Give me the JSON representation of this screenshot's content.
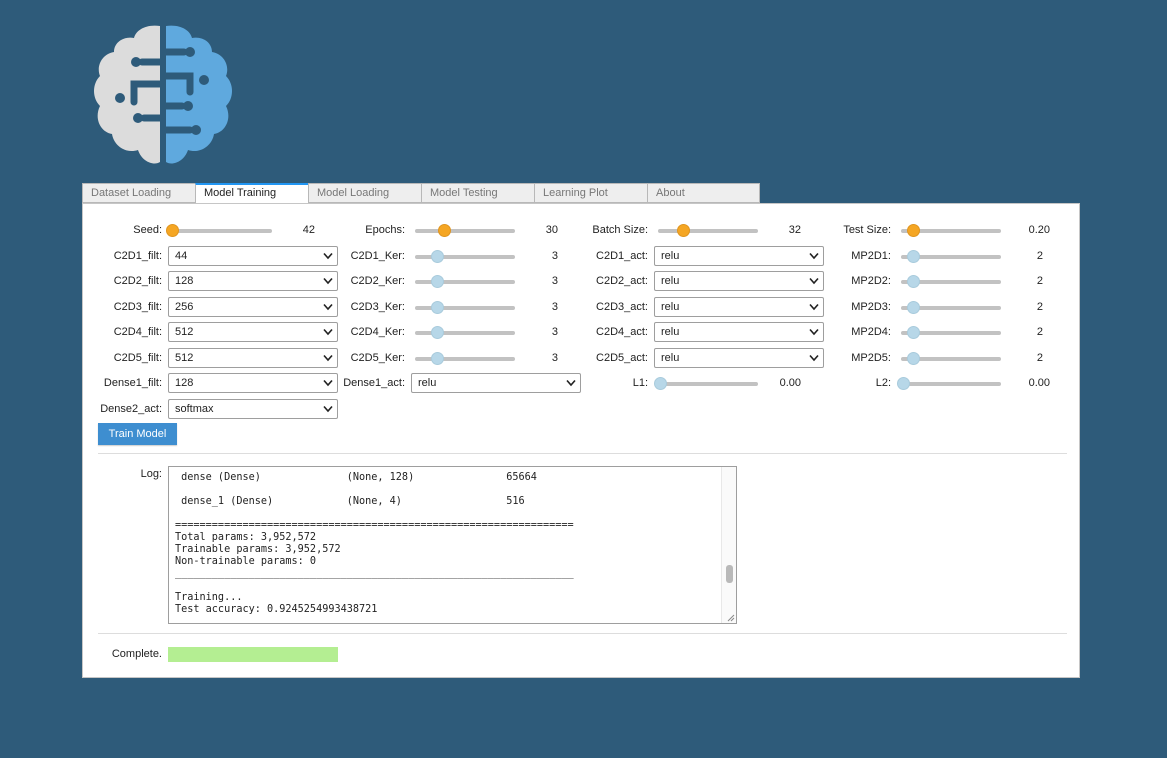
{
  "logo": {
    "icon": "brain-logo-icon",
    "colors": {
      "left": "#dcdcdc",
      "right": "#5fa9de"
    }
  },
  "tabs": [
    {
      "label": "Dataset Loading",
      "active": false
    },
    {
      "label": "Model Training",
      "active": true
    },
    {
      "label": "Model Loading",
      "active": false
    },
    {
      "label": "Model Testing",
      "active": false
    },
    {
      "label": "Learning Plot",
      "active": false
    },
    {
      "label": "About",
      "active": false
    }
  ],
  "sliders": {
    "seed": {
      "label": "Seed:",
      "value": "42"
    },
    "epochs": {
      "label": "Epochs:",
      "value": "30"
    },
    "batch_size": {
      "label": "Batch Size:",
      "value": "32"
    },
    "test_size": {
      "label": "Test Size:",
      "value": "0.20"
    },
    "c2d1_ker": {
      "label": "C2D1_Ker:",
      "value": "3"
    },
    "c2d2_ker": {
      "label": "C2D2_Ker:",
      "value": "3"
    },
    "c2d3_ker": {
      "label": "C2D3_Ker:",
      "value": "3"
    },
    "c2d4_ker": {
      "label": "C2D4_Ker:",
      "value": "3"
    },
    "c2d5_ker": {
      "label": "C2D5_Ker:",
      "value": "3"
    },
    "mp2d1": {
      "label": "MP2D1:",
      "value": "2"
    },
    "mp2d2": {
      "label": "MP2D2:",
      "value": "2"
    },
    "mp2d3": {
      "label": "MP2D3:",
      "value": "2"
    },
    "mp2d4": {
      "label": "MP2D4:",
      "value": "2"
    },
    "mp2d5": {
      "label": "MP2D5:",
      "value": "2"
    },
    "l1": {
      "label": "L1:",
      "value": "0.00"
    },
    "l2": {
      "label": "L2:",
      "value": "0.00"
    }
  },
  "selects": {
    "c2d1_filt": {
      "label": "C2D1_filt:",
      "value": "44"
    },
    "c2d2_filt": {
      "label": "C2D2_filt:",
      "value": "128"
    },
    "c2d3_filt": {
      "label": "C2D3_filt:",
      "value": "256"
    },
    "c2d4_filt": {
      "label": "C2D4_filt:",
      "value": "512"
    },
    "c2d5_filt": {
      "label": "C2D5_filt:",
      "value": "512"
    },
    "dense1_filt": {
      "label": "Dense1_filt:",
      "value": "128"
    },
    "dense2_act": {
      "label": "Dense2_act:",
      "value": "softmax"
    },
    "c2d1_act": {
      "label": "C2D1_act:",
      "value": "relu"
    },
    "c2d2_act": {
      "label": "C2D2_act:",
      "value": "relu"
    },
    "c2d3_act": {
      "label": "C2D3_act:",
      "value": "relu"
    },
    "c2d4_act": {
      "label": "C2D4_act:",
      "value": "relu"
    },
    "c2d5_act": {
      "label": "C2D5_act:",
      "value": "relu"
    },
    "dense1_act": {
      "label": "Dense1_act:",
      "value": "relu"
    }
  },
  "train_button": "Train Model",
  "log": {
    "label": "Log:",
    "text": " dense (Dense)              (None, 128)               65664\n\n dense_1 (Dense)            (None, 4)                 516\n\n=================================================================\nTotal params: 3,952,572\nTrainable params: 3,952,572\nNon-trainable params: 0\n_________________________________________________________________\n\nTraining...\nTest accuracy: 0.9245254993438721"
  },
  "progress": {
    "label": "Complete.",
    "fraction": 1.0,
    "color": "#b4ee92"
  },
  "colors": {
    "background": "#2e5b7a",
    "accent": "#2196f3",
    "button": "#3e8ed0",
    "knob_active": "#f5a623",
    "knob_idle": "#b7d7e8"
  }
}
